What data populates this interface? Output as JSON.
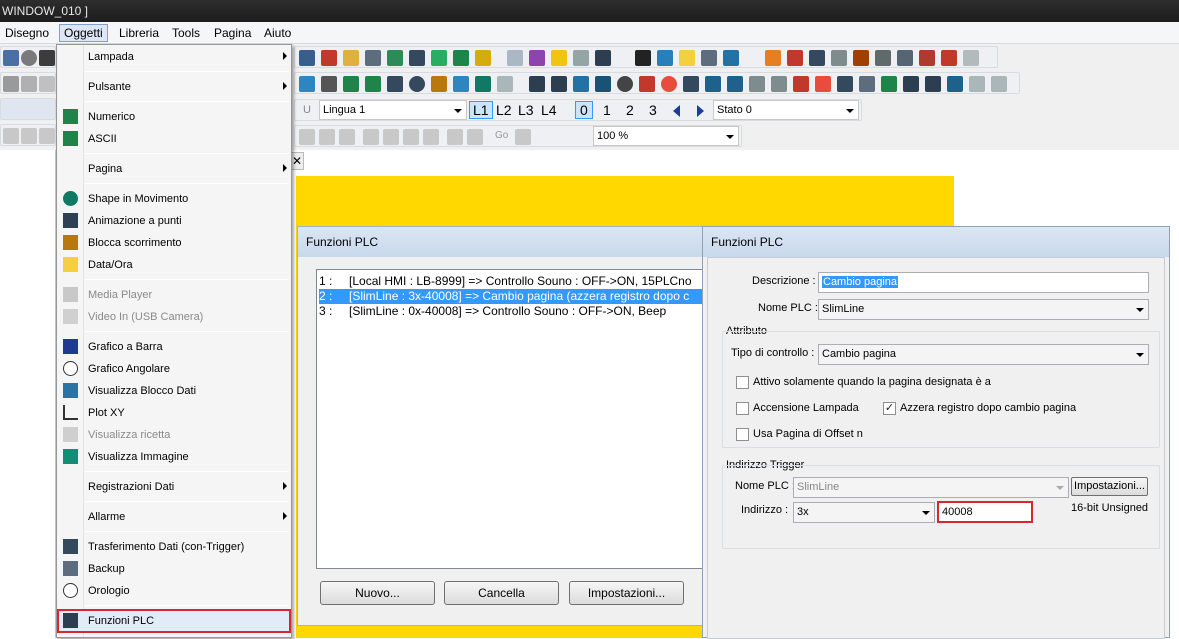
{
  "window": {
    "title": "WINDOW_010 ]"
  },
  "menubar": [
    "Disegno",
    "Oggetti",
    "Libreria",
    "Tools",
    "Pagina",
    "Aiuto"
  ],
  "toolbar": {
    "language": "Lingua 1",
    "layers": [
      "L1",
      "L2",
      "L3",
      "L4"
    ],
    "states": [
      "0",
      "1",
      "2",
      "3"
    ],
    "stato": "Stato  0",
    "go": "Go",
    "zoom": "100 %"
  },
  "menu": {
    "lampada": "Lampada",
    "pulsante": "Pulsante",
    "numerico": "Numerico",
    "ascii": "ASCII",
    "pagina": "Pagina",
    "shape": "Shape in Movimento",
    "animazione": "Animazione a punti",
    "blocca": "Blocca scorrimento",
    "dataora": "Data/Ora",
    "media": "Media Player",
    "video": "Video In (USB Camera)",
    "grafico_barra": "Grafico a Barra",
    "grafico_angolare": "Grafico Angolare",
    "blocco_dati": "Visualizza Blocco Dati",
    "plotxy": "Plot XY",
    "ricetta": "Visualizza ricetta",
    "immagine": "Visualizza Immagine",
    "registrazioni": "Registrazioni Dati",
    "allarme": "Allarme",
    "trasferimento": "Trasferimento Dati (con-Trigger)",
    "backup": "Backup",
    "orologio": "Orologio",
    "funzioni_plc": "Funzioni PLC"
  },
  "list_dialog": {
    "title": "Funzioni PLC",
    "rows": [
      {
        "num": "1 :",
        "text": "[Local HMI : LB-8999] => Controllo Souno : OFF->ON, 15PLCno"
      },
      {
        "num": "2 :",
        "text": "[SlimLine : 3x-40008] => Cambio pagina (azzera registro dopo c"
      },
      {
        "num": "3 :",
        "text": "[SlimLine : 0x-40008] => Controllo Souno : OFF->ON, Beep"
      }
    ],
    "buttons": {
      "nuovo": "Nuovo...",
      "cancella": "Cancella",
      "impostazioni": "Impostazioni..."
    }
  },
  "prop_dialog": {
    "title": "Funzioni PLC",
    "descrizione_label": "Descrizione :",
    "descrizione_value": "Cambio pagina",
    "nome_plc_label": "Nome PLC :",
    "nome_plc_value": "SlimLine",
    "attributo_label": "Attributo",
    "tipo_label": "Tipo di controllo :",
    "tipo_value": "Cambio pagina",
    "cb_attivo": "Attivo solamente quando la pagina designata è a",
    "cb_lampada": "Accensione Lampada",
    "cb_azzera": "Azzera registro dopo cambio pagina",
    "cb_offset": "Usa Pagina di Offset n",
    "trigger_label": "Indirizzo Trigger",
    "trig_nome_label": "Nome PLC :",
    "trig_nome_value": "SlimLine",
    "impostazioni": "Impostazioni...",
    "indirizzo_label": "Indirizzo :",
    "indirizzo_type": "3x",
    "indirizzo_value": "40008",
    "format": "16-bit Unsigned"
  },
  "colors": {
    "accent": "#3399ff",
    "highlight_box": "#d9272e",
    "canvas": "#ffd800"
  }
}
